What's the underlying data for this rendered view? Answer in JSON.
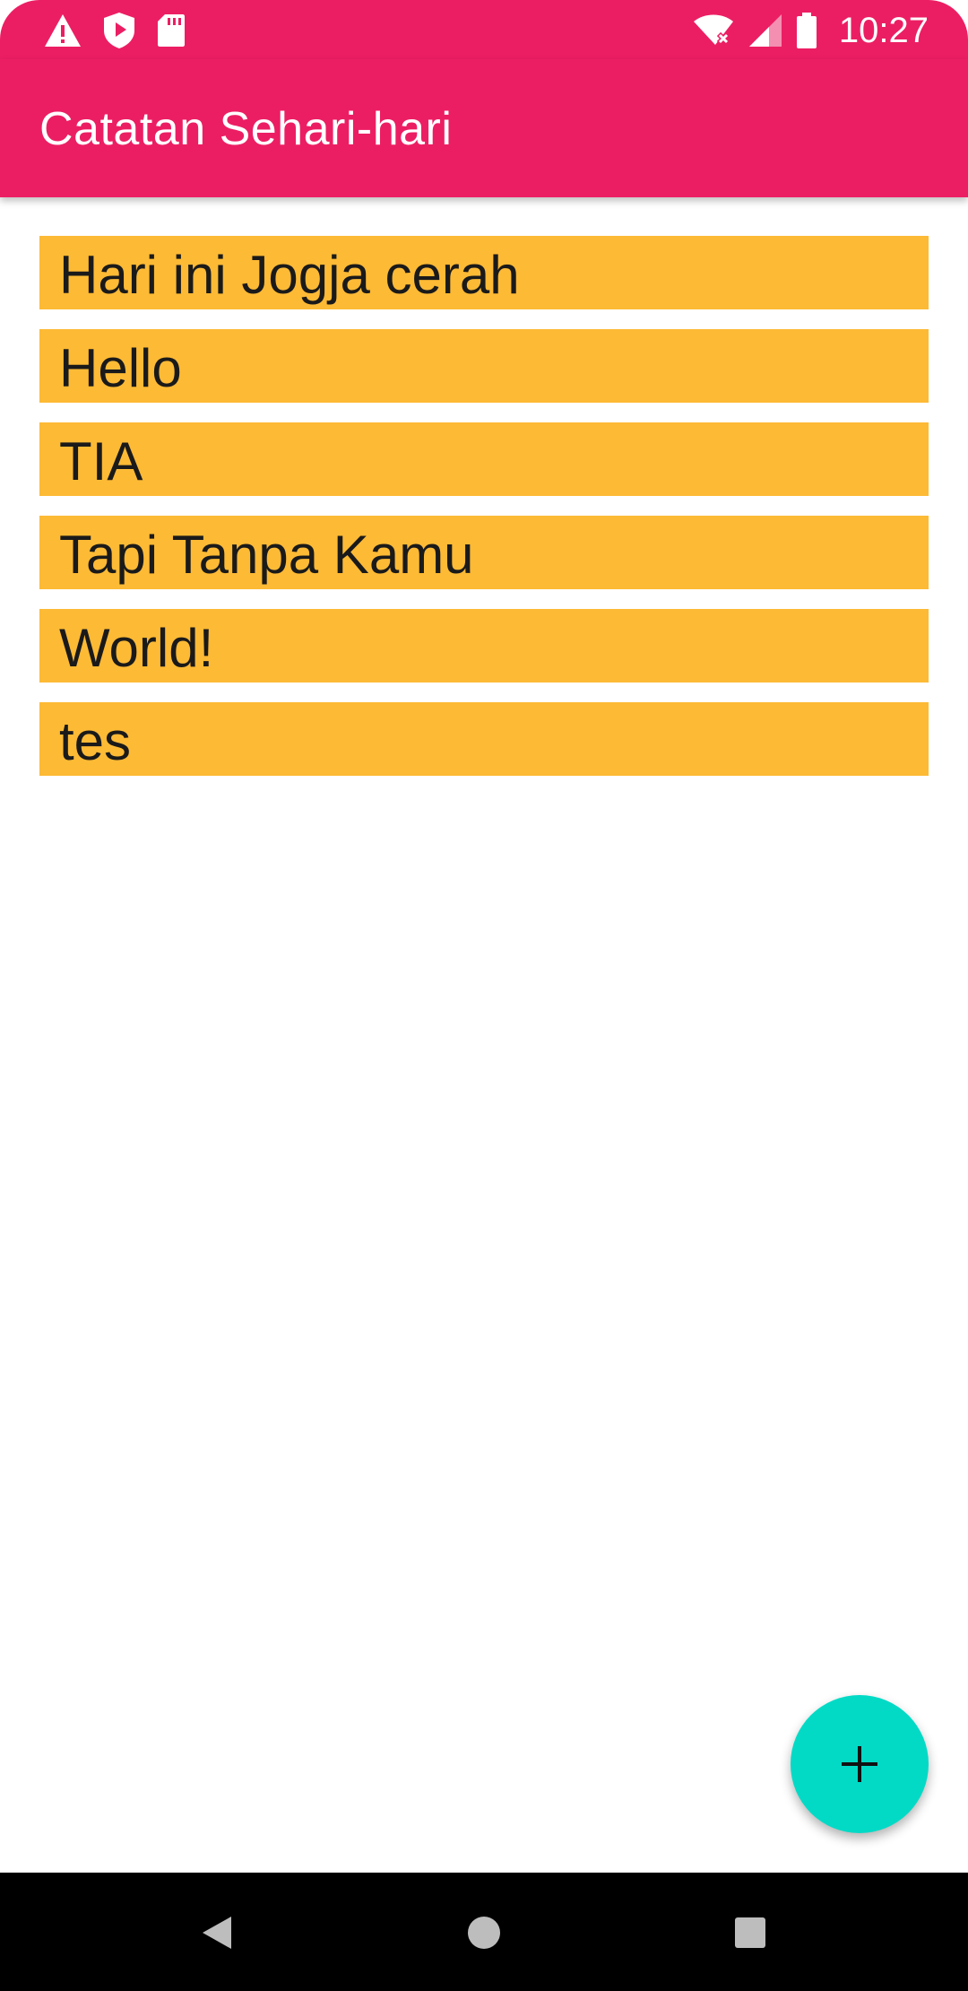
{
  "status_bar": {
    "time": "10:27",
    "left_icons": [
      "warning-icon",
      "shield-play-icon",
      "sd-card-icon"
    ],
    "right_icons": [
      "wifi-off-icon",
      "signal-icon",
      "battery-icon"
    ],
    "color": "#EC1E63"
  },
  "app_bar": {
    "title": "Catatan Sehari-hari",
    "color": "#EC1E63"
  },
  "notes": [
    {
      "text": "Hari ini Jogja cerah"
    },
    {
      "text": "Hello"
    },
    {
      "text": "TIA"
    },
    {
      "text": "Tapi Tanpa Kamu"
    },
    {
      "text": "World!"
    },
    {
      "text": "tes"
    }
  ],
  "note_color": "#FDBA35",
  "fab": {
    "icon": "plus-icon",
    "color": "#02DAC6"
  },
  "nav_bar": {
    "buttons": [
      "back-icon",
      "home-icon",
      "recents-icon"
    ]
  }
}
